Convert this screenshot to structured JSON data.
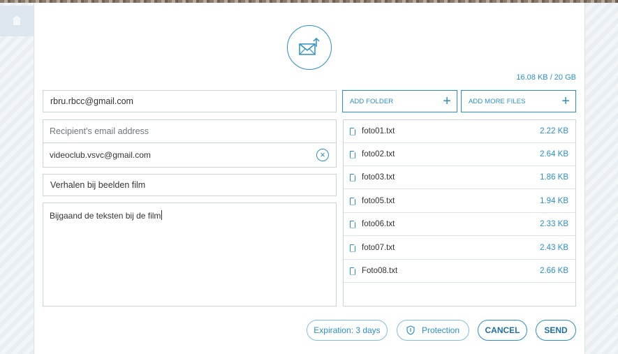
{
  "quota": "16.08 KB / 20 GB",
  "form": {
    "sender_email": "rbru.rbcc@gmail.com",
    "recipient_placeholder": "Recipient's email address",
    "recipients": [
      "videoclub.vsvc@gmail.com"
    ],
    "subject": "Verhalen bij beelden film",
    "message": "Bijgaand de teksten bij de film"
  },
  "buttons": {
    "add_folder": "ADD FOLDER",
    "add_files": "ADD MORE FILES",
    "expiration": "Expiration: 3 days",
    "protection": "Protection",
    "cancel": "CANCEL",
    "send": "SEND"
  },
  "files": [
    {
      "name": "foto01.txt",
      "size": "2.22 KB"
    },
    {
      "name": "foto02.txt",
      "size": "2.64 KB"
    },
    {
      "name": "foto03.txt",
      "size": "1.86 KB"
    },
    {
      "name": "foto05.txt",
      "size": "1.94 KB"
    },
    {
      "name": "foto06.txt",
      "size": "2.33 KB"
    },
    {
      "name": "foto07.txt",
      "size": "2.43 KB"
    },
    {
      "name": "Foto08.txt",
      "size": "2.66 KB"
    }
  ],
  "icons": {
    "header": "mail-upload-icon",
    "file": "file-icon",
    "remove": "close-circle-icon",
    "protection": "shield-icon",
    "add": "plus-icon",
    "home": "home-icon"
  },
  "colors": {
    "accent": "#2a8fc6",
    "text": "#333333",
    "border": "#c9d3da"
  }
}
